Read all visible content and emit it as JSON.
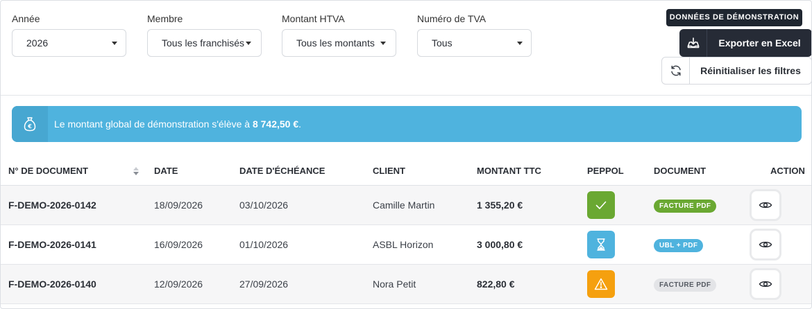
{
  "filters": {
    "year": {
      "label": "Année",
      "value": "2026"
    },
    "member": {
      "label": "Membre",
      "value": "Tous les franchisés"
    },
    "amount": {
      "label": "Montant HTVA",
      "value": "Tous les montants"
    },
    "vat": {
      "label": "Numéro de TVA",
      "value": "Tous"
    }
  },
  "actions": {
    "demo_badge": "DONNÉES DE DÉMONSTRATION",
    "export_label": "Exporter en Excel",
    "export_icon": "download-tray-icon",
    "reset_label": "Réinitialiser les filtres",
    "reset_icon": "refresh-icon"
  },
  "banner": {
    "icon": "money-bag-icon",
    "text_before": "Le montant global de démonstration s'élève à ",
    "amount": "8 742,50 €",
    "text_after": "."
  },
  "table": {
    "columns": [
      "N° de document",
      "Date",
      "Date d'échéance",
      "Client",
      "Montant TTC",
      "Peppol",
      "Document",
      "Action"
    ],
    "rows": [
      {
        "doc": "F-DEMO-2026-0142",
        "date": "18/09/2026",
        "due": "03/10/2026",
        "client": "Camille Martin",
        "amount": "1 355,20 €",
        "peppol": "check-icon",
        "peppol_color": "#6aa832",
        "document": "FACTURE PDF",
        "document_bg": "#6aa832",
        "document_fg": "#ffffff"
      },
      {
        "doc": "F-DEMO-2026-0141",
        "date": "16/09/2026",
        "due": "01/10/2026",
        "client": "ASBL Horizon",
        "amount": "3 000,80 €",
        "peppol": "hourglass-icon",
        "peppol_color": "#4fb3de",
        "document": "UBL + PDF",
        "document_bg": "#4fb3de",
        "document_fg": "#ffffff"
      },
      {
        "doc": "F-DEMO-2026-0140",
        "date": "12/09/2026",
        "due": "27/09/2026",
        "client": "Nora Petit",
        "amount": "822,80 €",
        "peppol": "warning-icon",
        "peppol_color": "#f5a00f",
        "document": "FACTURE PDF",
        "document_bg": "#e3e4e7",
        "document_fg": "#555a62"
      }
    ]
  }
}
